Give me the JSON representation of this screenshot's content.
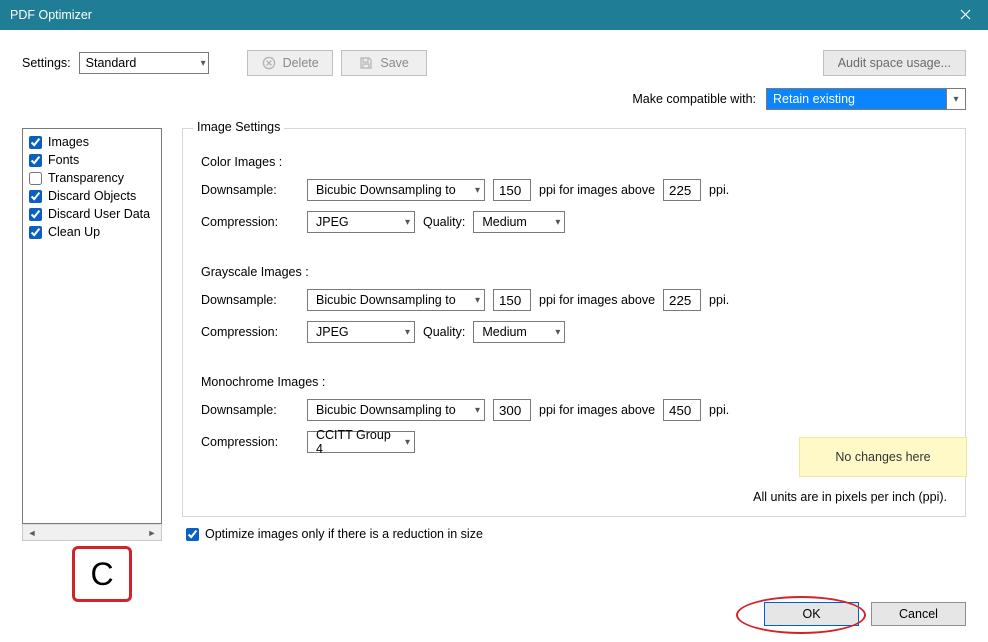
{
  "window": {
    "title": "PDF Optimizer"
  },
  "toolbar": {
    "settings_label": "Settings:",
    "settings_value": "Standard",
    "delete_label": "Delete",
    "save_label": "Save",
    "audit_label": "Audit space usage..."
  },
  "compat": {
    "label": "Make compatible with:",
    "value": "Retain existing"
  },
  "sidebar": {
    "items": [
      {
        "label": "Images",
        "checked": true
      },
      {
        "label": "Fonts",
        "checked": true
      },
      {
        "label": "Transparency",
        "checked": false
      },
      {
        "label": "Discard Objects",
        "checked": true
      },
      {
        "label": "Discard User Data",
        "checked": true
      },
      {
        "label": "Clean Up",
        "checked": true
      }
    ]
  },
  "panel": {
    "legend": "Image Settings",
    "labels": {
      "downsample": "Downsample:",
      "compression": "Compression:",
      "quality": "Quality:",
      "ppi_above": "ppi for images above",
      "ppi": "ppi."
    },
    "color": {
      "title": "Color Images :",
      "downsample_method": "Bicubic Downsampling to",
      "ppi": "150",
      "above_ppi": "225",
      "compression": "JPEG",
      "quality": "Medium"
    },
    "gray": {
      "title": "Grayscale Images :",
      "downsample_method": "Bicubic Downsampling to",
      "ppi": "150",
      "above_ppi": "225",
      "compression": "JPEG",
      "quality": "Medium"
    },
    "mono": {
      "title": "Monochrome Images :",
      "downsample_method": "Bicubic Downsampling to",
      "ppi": "300",
      "above_ppi": "450",
      "compression": "CCITT Group 4"
    },
    "note": "No changes here",
    "units_note": "All units are in pixels per inch (ppi)."
  },
  "options": {
    "optimize_only_if_reduction": "Optimize images only if there is a reduction in size",
    "optimize_checked": true
  },
  "buttons": {
    "ok": "OK",
    "cancel": "Cancel"
  },
  "annotation": {
    "c": "C"
  }
}
